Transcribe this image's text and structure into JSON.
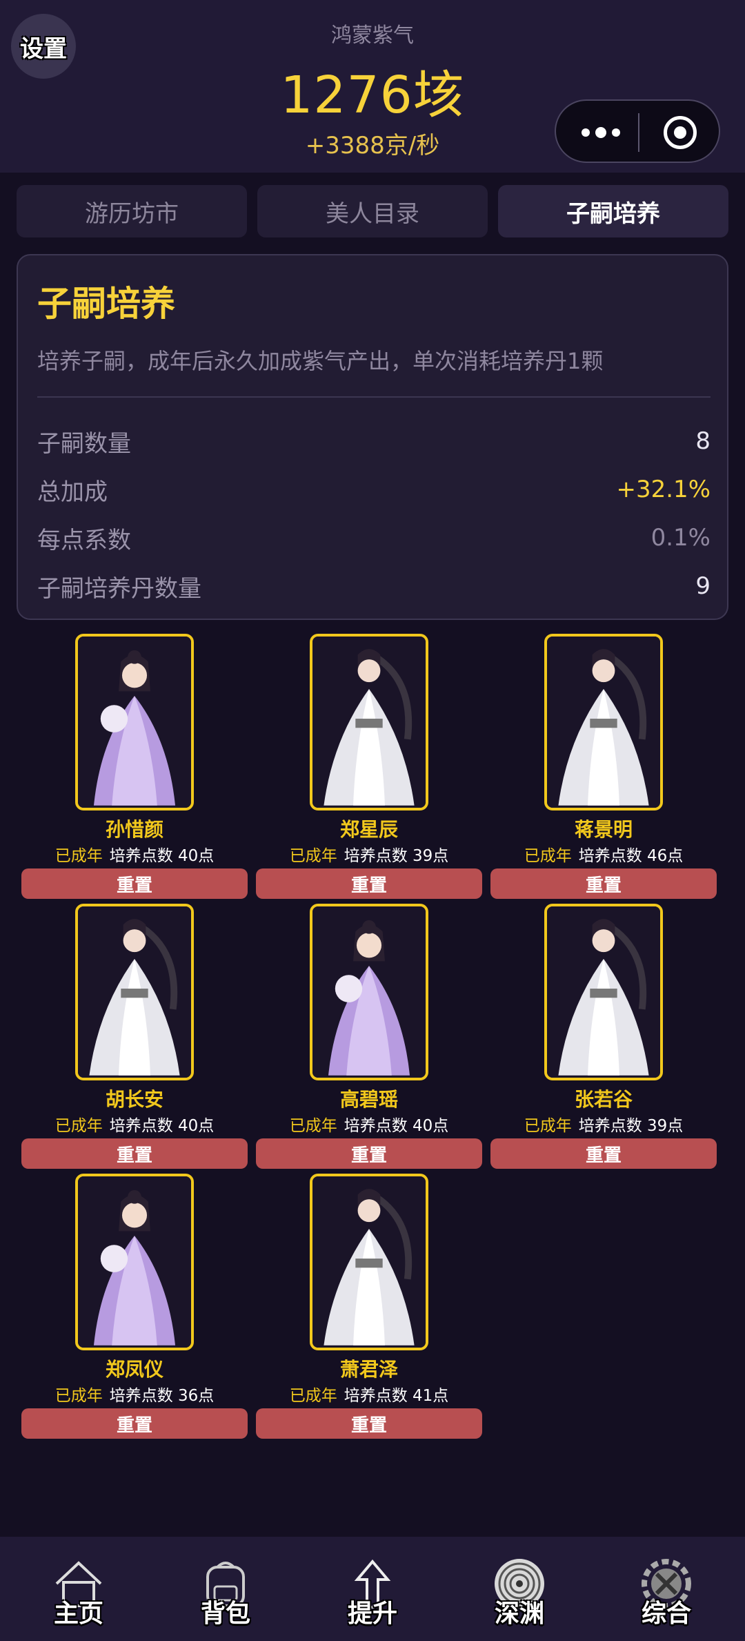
{
  "header": {
    "settings_label": "设置",
    "resource_name": "鸿蒙紫气",
    "resource_value": "1276垓",
    "resource_rate": "+3388京/秒"
  },
  "tabs": [
    {
      "label": "游历坊市",
      "active": false
    },
    {
      "label": "美人目录",
      "active": false
    },
    {
      "label": "子嗣培养",
      "active": true
    }
  ],
  "panel": {
    "title": "子嗣培养",
    "description": "培养子嗣，成年后永久加成紫气产出，单次消耗培养丹1颗",
    "stats": [
      {
        "label": "子嗣数量",
        "value": "8"
      },
      {
        "label": "总加成",
        "value": "+32.1%"
      },
      {
        "label": "每点系数",
        "value": "0.1%"
      },
      {
        "label": "子嗣培养丹数量",
        "value": "9"
      }
    ]
  },
  "children": [
    {
      "name": "孙惜颜",
      "status": "已成年",
      "points": "培养点数 40点",
      "button": "重置",
      "portrait": "female"
    },
    {
      "name": "郑星辰",
      "status": "已成年",
      "points": "培养点数 39点",
      "button": "重置",
      "portrait": "male"
    },
    {
      "name": "蒋景明",
      "status": "已成年",
      "points": "培养点数 46点",
      "button": "重置",
      "portrait": "male"
    },
    {
      "name": "胡长安",
      "status": "已成年",
      "points": "培养点数 40点",
      "button": "重置",
      "portrait": "male"
    },
    {
      "name": "高碧瑶",
      "status": "已成年",
      "points": "培养点数 40点",
      "button": "重置",
      "portrait": "female"
    },
    {
      "name": "张若谷",
      "status": "已成年",
      "points": "培养点数 39点",
      "button": "重置",
      "portrait": "male"
    },
    {
      "name": "郑凤仪",
      "status": "已成年",
      "points": "培养点数 36点",
      "button": "重置",
      "portrait": "female"
    },
    {
      "name": "萧君泽",
      "status": "已成年",
      "points": "培养点数 41点",
      "button": "重置",
      "portrait": "male"
    }
  ],
  "bottom_nav": [
    {
      "label": "主页",
      "icon": "home-icon"
    },
    {
      "label": "背包",
      "icon": "backpack-icon"
    },
    {
      "label": "提升",
      "icon": "arrow-up-icon"
    },
    {
      "label": "深渊",
      "icon": "vortex-icon"
    },
    {
      "label": "综合",
      "icon": "gear-icon"
    }
  ],
  "colors": {
    "background": "#140f22",
    "header": "#211a36",
    "accent_gold": "#f7d23a",
    "reset_button": "#b84f51"
  }
}
